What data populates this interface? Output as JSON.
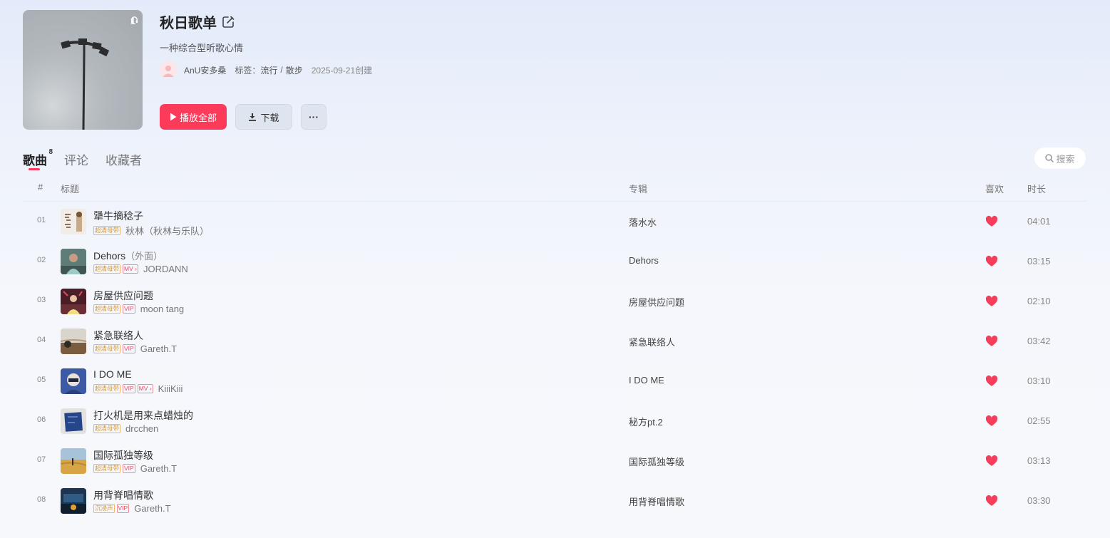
{
  "playlist": {
    "title": "秋日歌单",
    "description": "一种综合型听歌心情",
    "play_count": "1",
    "creator": "AnU安多桑",
    "tags_label": "标签：",
    "tags": [
      "流行",
      "散步"
    ],
    "tag_separator": "/",
    "created": "2025-09-21创建"
  },
  "actions": {
    "play_all_label": "播放全部",
    "download_label": "下载",
    "more_label": "···"
  },
  "tabs": [
    {
      "label": "歌曲",
      "count": "8",
      "active": true
    },
    {
      "label": "评论"
    },
    {
      "label": "收藏者"
    }
  ],
  "search": {
    "placeholder": "搜索"
  },
  "columns": {
    "num": "#",
    "title": "标题",
    "album": "专辑",
    "like": "喜欢",
    "duration": "时长"
  },
  "colors": {
    "accent": "#fc3b5b",
    "heart": "#f53d5c",
    "gold_badge": "#d39a3d"
  },
  "songs": [
    {
      "num": "01",
      "title": "犟牛摘稔子",
      "subtitle": "",
      "badges": [
        {
          "text": "超清母带",
          "style": "gold"
        }
      ],
      "artist": "秋林（秋林与乐队）",
      "album": "落水水",
      "liked": true,
      "duration": "04:01"
    },
    {
      "num": "02",
      "title": "Dehors",
      "subtitle": "（外面）",
      "badges": [
        {
          "text": "超清母带",
          "style": "gold"
        },
        {
          "text": "MV ›",
          "style": "red"
        }
      ],
      "artist": "JORDANN",
      "album": "Dehors",
      "liked": true,
      "duration": "03:15"
    },
    {
      "num": "03",
      "title": "房屋供应问题",
      "subtitle": "",
      "badges": [
        {
          "text": "超清母带",
          "style": "gold"
        },
        {
          "text": "VIP",
          "style": "red"
        }
      ],
      "artist": "moon tang",
      "album": "房屋供应问题",
      "liked": true,
      "duration": "02:10"
    },
    {
      "num": "04",
      "title": "紧急联络人",
      "subtitle": "",
      "badges": [
        {
          "text": "超清母带",
          "style": "gold"
        },
        {
          "text": "VIP",
          "style": "red"
        }
      ],
      "artist": "Gareth.T",
      "album": "紧急联络人",
      "liked": true,
      "duration": "03:42"
    },
    {
      "num": "05",
      "title": "I DO ME",
      "subtitle": "",
      "badges": [
        {
          "text": "超清母带",
          "style": "gold"
        },
        {
          "text": "VIP",
          "style": "red"
        },
        {
          "text": "MV ›",
          "style": "red"
        }
      ],
      "artist": "KiiiKiii",
      "album": "I DO ME",
      "liked": true,
      "duration": "03:10"
    },
    {
      "num": "06",
      "title": "打火机是用来点蜡烛的",
      "subtitle": "",
      "badges": [
        {
          "text": "超清母带",
          "style": "gold"
        }
      ],
      "artist": "drcchen",
      "album": "秘方pt.2",
      "liked": true,
      "duration": "02:55"
    },
    {
      "num": "07",
      "title": "国际孤独等级",
      "subtitle": "",
      "badges": [
        {
          "text": "超清母带",
          "style": "gold"
        },
        {
          "text": "VIP",
          "style": "red"
        }
      ],
      "artist": "Gareth.T",
      "album": "国际孤独等级",
      "liked": true,
      "duration": "03:13"
    },
    {
      "num": "08",
      "title": "用背脊唱情歌",
      "subtitle": "",
      "badges": [
        {
          "text": "沉浸声",
          "style": "gold"
        },
        {
          "text": "VIP",
          "style": "red"
        }
      ],
      "artist": "Gareth.T",
      "album": "用背脊唱情歌",
      "liked": true,
      "duration": "03:30"
    }
  ]
}
